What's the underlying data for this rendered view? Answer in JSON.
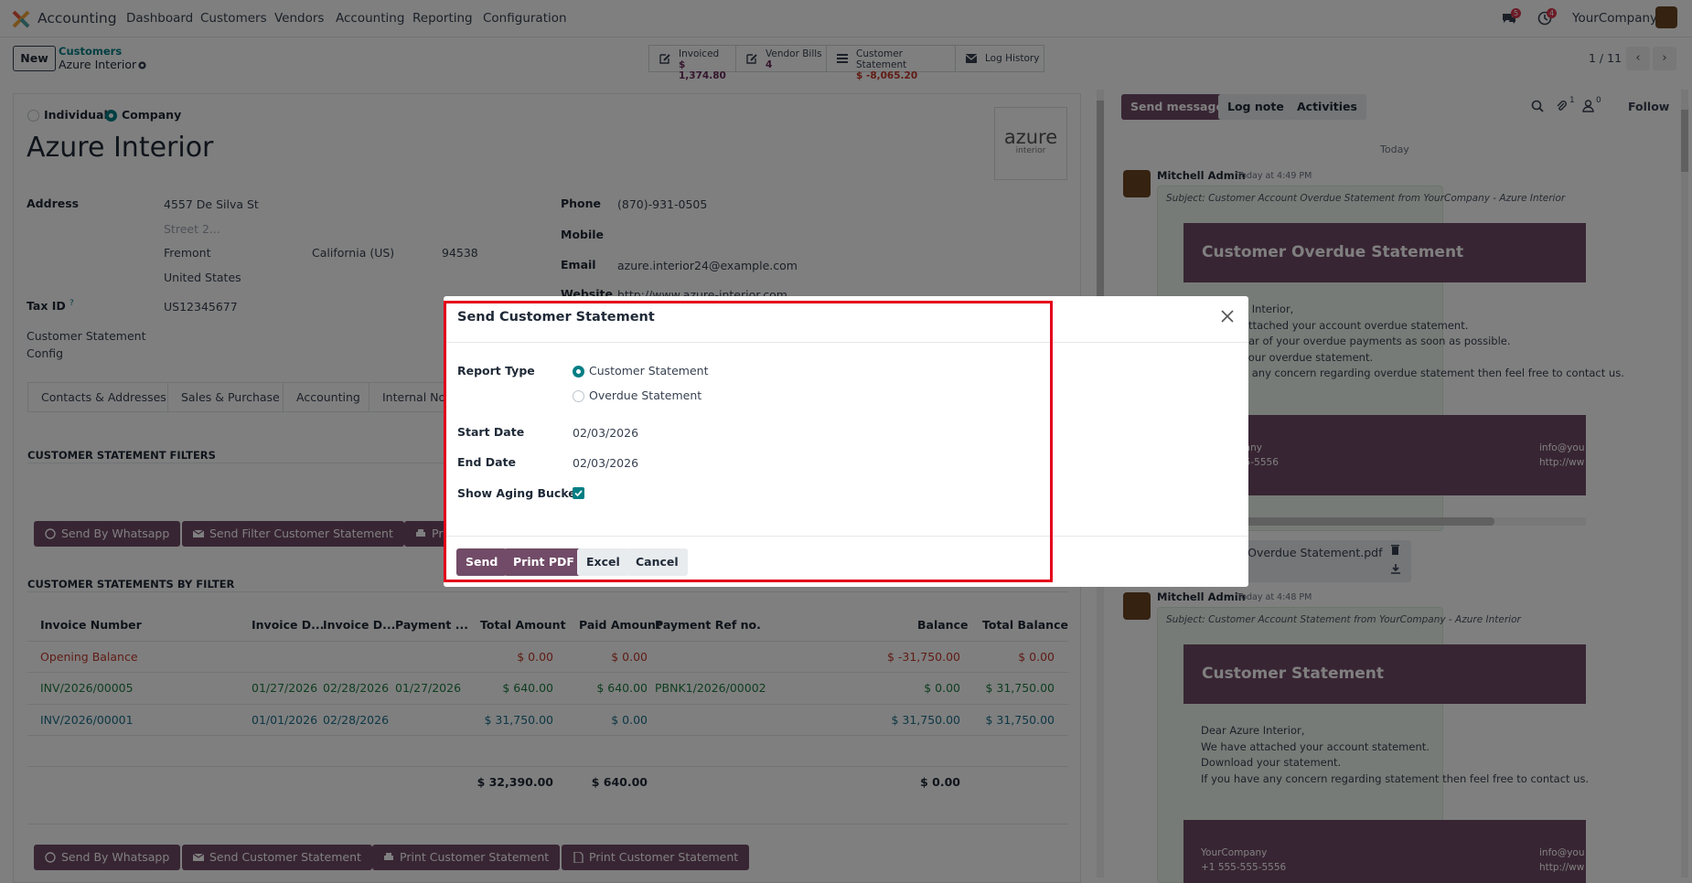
{
  "navbar": {
    "app_name": "Accounting",
    "menu": [
      "Dashboard",
      "Customers",
      "Vendors",
      "Accounting",
      "Reporting",
      "Configuration"
    ],
    "messages_badge": "5",
    "activities_badge": "4",
    "company": "YourCompany"
  },
  "control": {
    "new_label": "New",
    "breadcrumb_parent": "Customers",
    "breadcrumb_current": "Azure Interior",
    "stats": [
      {
        "label": "Invoiced",
        "value": "$ 1,374.80"
      },
      {
        "label": "Vendor Bills",
        "value": "4"
      },
      {
        "label": "Customer Statement",
        "value": "$ -8,065.20"
      },
      {
        "label": "Log History",
        "value": ""
      }
    ],
    "pager": "1 / 11"
  },
  "form": {
    "type_individual": "Individual",
    "type_company": "Company",
    "name": "Azure Interior",
    "logo_text": "azure",
    "logo_sub": "interior",
    "address_label": "Address",
    "street": "4557 De Silva St",
    "street2_placeholder": "Street 2...",
    "city": "Fremont",
    "state": "California (US)",
    "zip": "94538",
    "country": "United States",
    "tax_label": "Tax ID",
    "tax_help": "?",
    "tax_value": "US12345677",
    "stmt_config_label_1": "Customer Statement",
    "stmt_config_label_2": "Config",
    "phone_label": "Phone",
    "phone": "(870)-931-0505",
    "mobile_label": "Mobile",
    "email_label": "Email",
    "email": "azure.interior24@example.com",
    "website_label": "Website",
    "website": "http://www.azure-interior.com",
    "tabs": [
      "Contacts & Addresses",
      "Sales & Purchase",
      "Accounting",
      "Internal No"
    ],
    "filters_heading": "CUSTOMER STATEMENT FILTERS",
    "filter_buttons": [
      "Send By Whatsapp",
      "Send Filter Customer Statement",
      "Pr"
    ],
    "by_filter_heading": "CUSTOMER STATEMENTS BY FILTER",
    "table_headers": [
      "Invoice Number",
      "Invoice D...",
      "Invoice D...",
      "Payment ...",
      "Total Amount",
      "Paid Amount",
      "Payment Ref no.",
      "Balance",
      "Total Balance"
    ],
    "rows": [
      {
        "inv": "Opening Balance",
        "d1": "",
        "d2": "",
        "pay": "",
        "total": "$ 0.00",
        "paid": "$ 0.00",
        "ref": "",
        "balance": "$ -31,750.00",
        "total_balance": "$ 0.00"
      },
      {
        "inv": "INV/2026/00005",
        "d1": "01/27/2026",
        "d2": "02/28/2026",
        "pay": "01/27/2026",
        "total": "$ 640.00",
        "paid": "$ 640.00",
        "ref": "PBNK1/2026/00002",
        "balance": "$ 0.00",
        "total_balance": "$ 31,750.00"
      },
      {
        "inv": "INV/2026/00001",
        "d1": "01/01/2026",
        "d2": "02/28/2026",
        "pay": "",
        "total": "$ 31,750.00",
        "paid": "$ 0.00",
        "ref": "",
        "balance": "$ 31,750.00",
        "total_balance": "$ 31,750.00"
      }
    ],
    "totals": {
      "total": "$ 32,390.00",
      "paid": "$ 640.00",
      "balance": "$ 0.00"
    },
    "bottom_buttons": [
      "Send By Whatsapp",
      "Send Customer Statement",
      "Print Customer Statement",
      "Print Customer Statement"
    ]
  },
  "chatter": {
    "send_message": "Send message",
    "log_note": "Log note",
    "activities": "Activities",
    "attach_count": "1",
    "follower_count": "0",
    "follow": "Follow",
    "today": "Today",
    "messages": [
      {
        "author": "Mitchell Admin",
        "time": "Today at 4:49 PM",
        "subject": "Subject: Customer Account Overdue Statement from YourCompany - Azure Interior",
        "header": "Customer Overdue Statement",
        "lines": [
          "e Interior,",
          "attached your account overdue statement.",
          "ear of your overdue payments as soon as possible.",
          "your overdue statement.",
          "e any concern regarding overdue statement then feel free to contact us."
        ],
        "footer_left_1": "pany",
        "footer_left_2": "55-5556",
        "footer_right_1": "info@you",
        "footer_right_2": "http://ww",
        "attachment": "r Overdue Statement.pdf"
      },
      {
        "author": "Mitchell Admin",
        "time": "Today at 4:48 PM",
        "subject": "Subject: Customer Account Statement from YourCompany - Azure Interior",
        "header": "Customer Statement",
        "lines": [
          "Dear Azure Interior,",
          "We have attached your account statement.",
          "Download your statement.",
          "If you have any concern regarding statement then feel free to contact us."
        ],
        "footer_left_1": "YourCompany",
        "footer_left_2": "+1 555-555-5556",
        "footer_right_1": "info@you",
        "footer_right_2": "http://ww"
      }
    ]
  },
  "modal": {
    "title": "Send Customer Statement",
    "report_type_label": "Report Type",
    "option_customer": "Customer Statement",
    "option_overdue": "Overdue Statement",
    "start_label": "Start Date",
    "start_value": "02/03/2026",
    "end_label": "End Date",
    "end_value": "02/03/2026",
    "aging_label": "Show Aging Bucket",
    "buttons": {
      "send": "Send",
      "print_pdf": "Print PDF",
      "excel": "Excel",
      "cancel": "Cancel"
    }
  },
  "colors": {
    "brand": "#714b67",
    "accent": "#017e84",
    "highlight": "#e3001b"
  }
}
